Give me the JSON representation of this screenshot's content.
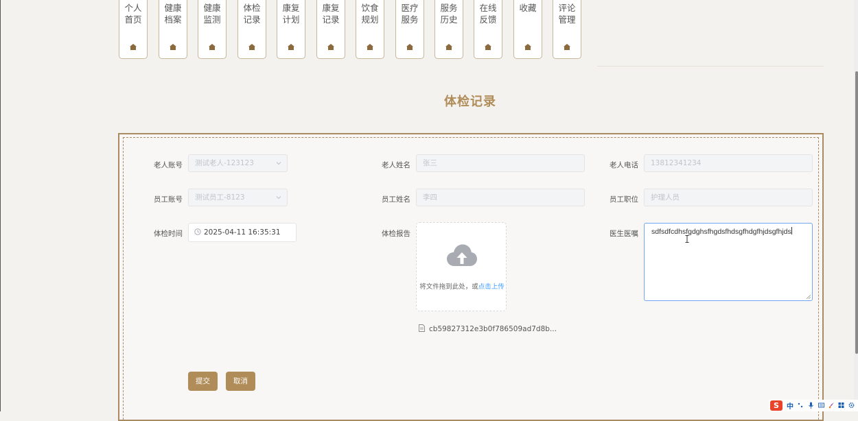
{
  "nav": {
    "items": [
      {
        "label": "个人首页"
      },
      {
        "label": "健康档案"
      },
      {
        "label": "健康监测"
      },
      {
        "label": "体检记录"
      },
      {
        "label": "康复计划"
      },
      {
        "label": "康复记录"
      },
      {
        "label": "饮食规划"
      },
      {
        "label": "医疗服务"
      },
      {
        "label": "服务历史"
      },
      {
        "label": "在线反馈"
      },
      {
        "label": "收藏"
      },
      {
        "label": "评论管理"
      }
    ]
  },
  "page": {
    "title": "体检记录"
  },
  "form": {
    "elder_account": {
      "label": "老人账号",
      "value": "测试老人-123123"
    },
    "elder_name": {
      "label": "老人姓名",
      "value": "张三"
    },
    "elder_phone": {
      "label": "老人电话",
      "value": "13812341234"
    },
    "staff_account": {
      "label": "员工账号",
      "value": "测试员工-8123"
    },
    "staff_name": {
      "label": "员工姓名",
      "value": "李四"
    },
    "staff_position": {
      "label": "员工职位",
      "value": "护理人员"
    },
    "exam_time": {
      "label": "体检时间",
      "value": "2025-04-11 16:35:31"
    },
    "exam_report": {
      "label": "体检报告",
      "upload_hint": "将文件拖到此处，或",
      "upload_link": "点击上传",
      "file_name": "cb59827312e3b0f786509ad7d8b..."
    },
    "doctor_advice": {
      "label": "医生医嘱",
      "value": "sdfsdfcdhsfgdghsfhgdsfhdsgfhdgfhjdsgfhjds"
    },
    "submit_label": "提交",
    "cancel_label": "取消"
  },
  "ime": {
    "brand": "S",
    "lang": "中"
  },
  "colors": {
    "accent": "#b08c58",
    "border": "#a98a62",
    "link": "#409eff"
  }
}
